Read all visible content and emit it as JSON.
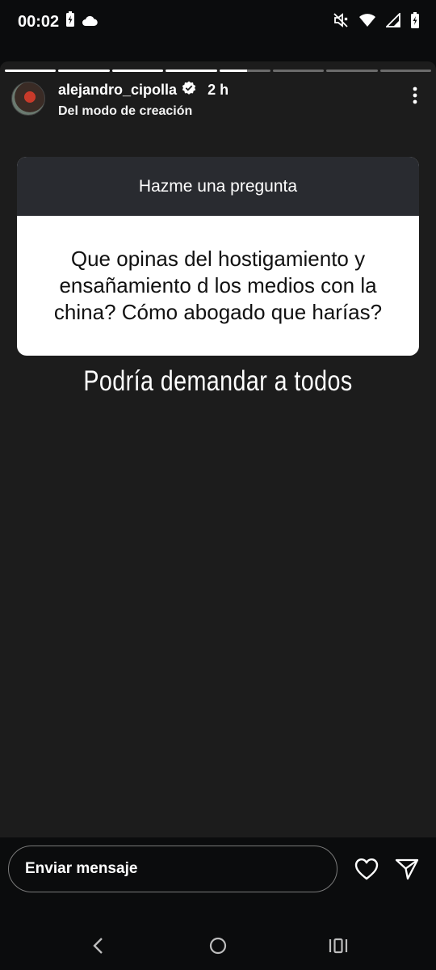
{
  "status_bar": {
    "time": "00:02",
    "icons": [
      "battery-saver-icon",
      "cloud-icon",
      "mute-icon",
      "wifi-icon",
      "signal-icon",
      "battery-icon"
    ]
  },
  "story": {
    "segments": [
      1,
      1,
      1,
      1,
      0.55,
      0,
      0,
      0
    ],
    "username": "alejandro_cipolla",
    "verified": true,
    "time_ago": "2 h",
    "subtitle": "Del modo de creación",
    "question_box": {
      "header": "Hazme una pregunta",
      "question": "Que opinas del hostigamiento y ensañamiento d los medios con la china? Cómo abogado que harías?"
    },
    "answer": "Podría demandar a todos"
  },
  "bottom": {
    "message_placeholder": "Enviar mensaje",
    "icons": [
      "heart-icon",
      "send-icon"
    ]
  },
  "nav": {
    "icons": [
      "back-icon",
      "home-icon",
      "recents-icon"
    ]
  },
  "colors": {
    "story_bg": "#1c1c1c",
    "app_bg": "#0b0c0d",
    "question_header_bg": "#292b30",
    "question_body_bg": "#ffffff"
  }
}
